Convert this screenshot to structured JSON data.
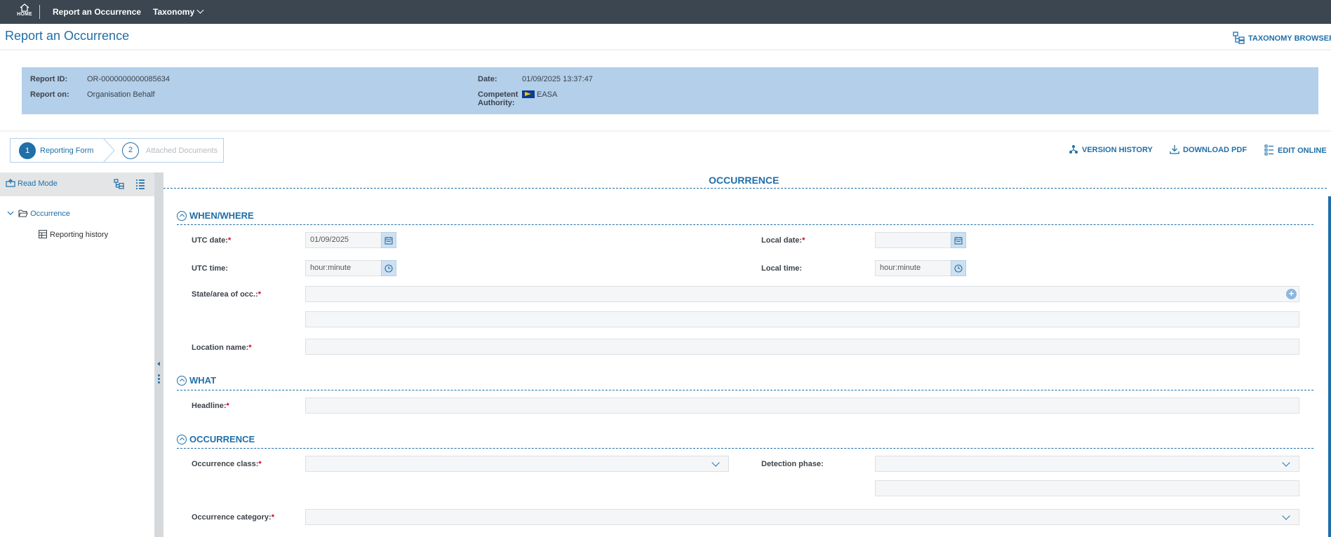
{
  "topbar": {
    "home_label": "HOME",
    "nav_report": "Report an Occurrence",
    "nav_taxonomy": "Taxonomy"
  },
  "page": {
    "title": "Report an Occurrence",
    "taxonomy_browser": "TAXONOMY BROWSER"
  },
  "info": {
    "report_id_label": "Report ID:",
    "report_id": "OR-0000000000085634",
    "report_on_label": "Report on:",
    "report_on": "Organisation Behalf",
    "date_label": "Date:",
    "date": "01/09/2025 13:37:47",
    "authority_label_1": "Competent",
    "authority_label_2": "Authority:",
    "authority": "EASA"
  },
  "steps": [
    {
      "number": "1",
      "label": "Reporting Form"
    },
    {
      "number": "2",
      "label": "Attached Documents"
    }
  ],
  "actions": {
    "version_history": "VERSION HISTORY",
    "download_pdf": "DOWNLOAD PDF",
    "edit_online": "EDIT ONLINE"
  },
  "left_panel": {
    "read_mode": "Read Mode",
    "tree_occurrence": "Occurrence",
    "tree_reporting_history": "Reporting history"
  },
  "form": {
    "section_title": "OCCURRENCE",
    "when_where": "WHEN/WHERE",
    "utc_date_label": "UTC date:",
    "utc_date_value": "01/09/2025",
    "local_date_label": "Local date:",
    "utc_time_label": "UTC time:",
    "utc_time_placeholder": "hour:minute",
    "local_time_label": "Local time:",
    "local_time_placeholder": "hour:minute",
    "state_area_label": "State/area of occ.:",
    "location_name_label": "Location name:",
    "what": "WHAT",
    "headline_label": "Headline:",
    "occurrence_sub": "OCCURRENCE",
    "occurrence_class_label": "Occurrence class:",
    "detection_phase_label": "Detection phase:",
    "occurrence_category_label": "Occurrence category:",
    "required_mark": "*"
  },
  "colors": {
    "topbar": "#3b4650",
    "accent": "#1f6fa8",
    "info_panel": "#b3cfea",
    "required": "#d0021b"
  }
}
